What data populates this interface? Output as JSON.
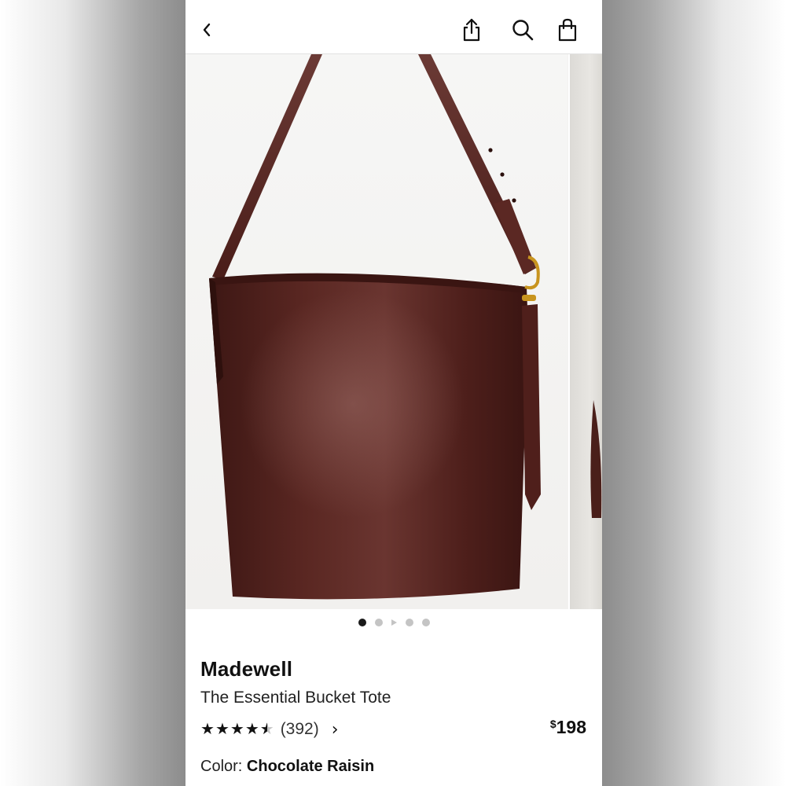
{
  "header": {
    "back_icon": "chevron-left-icon",
    "share_icon": "share-icon",
    "search_icon": "search-icon",
    "bag_icon": "shopping-bag-icon"
  },
  "gallery": {
    "image_count": 5,
    "active_index": 0,
    "bag_color": "#4a1f1a",
    "hardware_color": "#c8941e"
  },
  "product": {
    "brand": "Madewell",
    "name": "The Essential Bucket Tote",
    "rating": 4.5,
    "review_count": "(392)",
    "price_currency": "$",
    "price_amount": "198",
    "color_label": "Color:",
    "color_value": "Chocolate Raisin"
  }
}
